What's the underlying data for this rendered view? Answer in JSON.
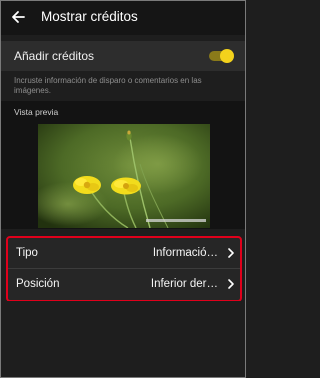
{
  "header": {
    "back_icon": "arrow-left-icon",
    "title": "Mostrar créditos"
  },
  "add_credits": {
    "label": "Añadir créditos",
    "toggle_on": true,
    "toggle_color": "#f3d21c"
  },
  "description": "Incruste información de disparo o comentarios en las imágenes.",
  "preview": {
    "label": "Vista previa"
  },
  "settings": [
    {
      "label": "Tipo",
      "value": "Informació…",
      "chevron_icon": "chevron-right-icon"
    },
    {
      "label": "Posición",
      "value": "Inferior der…",
      "chevron_icon": "chevron-right-icon"
    }
  ],
  "highlight_color": "#e0001b"
}
